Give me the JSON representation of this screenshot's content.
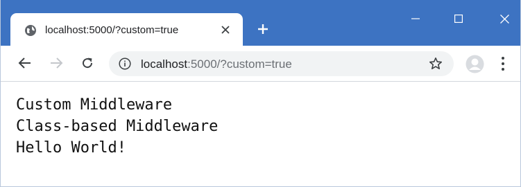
{
  "tab": {
    "title": "localhost:5000/?custom=true",
    "favicon": "globe-icon",
    "close_icon": "close-icon"
  },
  "new_tab_icon": "plus-icon",
  "window_controls": [
    "minimize-icon",
    "maximize-icon",
    "close-icon"
  ],
  "toolbar": {
    "back_icon": "arrow-left-icon",
    "forward_icon": "arrow-right-icon",
    "reload_icon": "reload-icon",
    "address": {
      "host": "localhost",
      "rest": ":5000/?custom=true",
      "site_info_icon": "info-icon"
    },
    "bookmark_icon": "star-icon",
    "profile_icon": "avatar-icon",
    "menu_icon": "kebab-menu-icon"
  },
  "page": {
    "lines": [
      "Custom Middleware",
      "Class-based Middleware",
      "Hello World!"
    ]
  },
  "colors": {
    "titlebar": "#3d73c2",
    "omnibox": "#f1f3f4",
    "text": "#111111"
  }
}
